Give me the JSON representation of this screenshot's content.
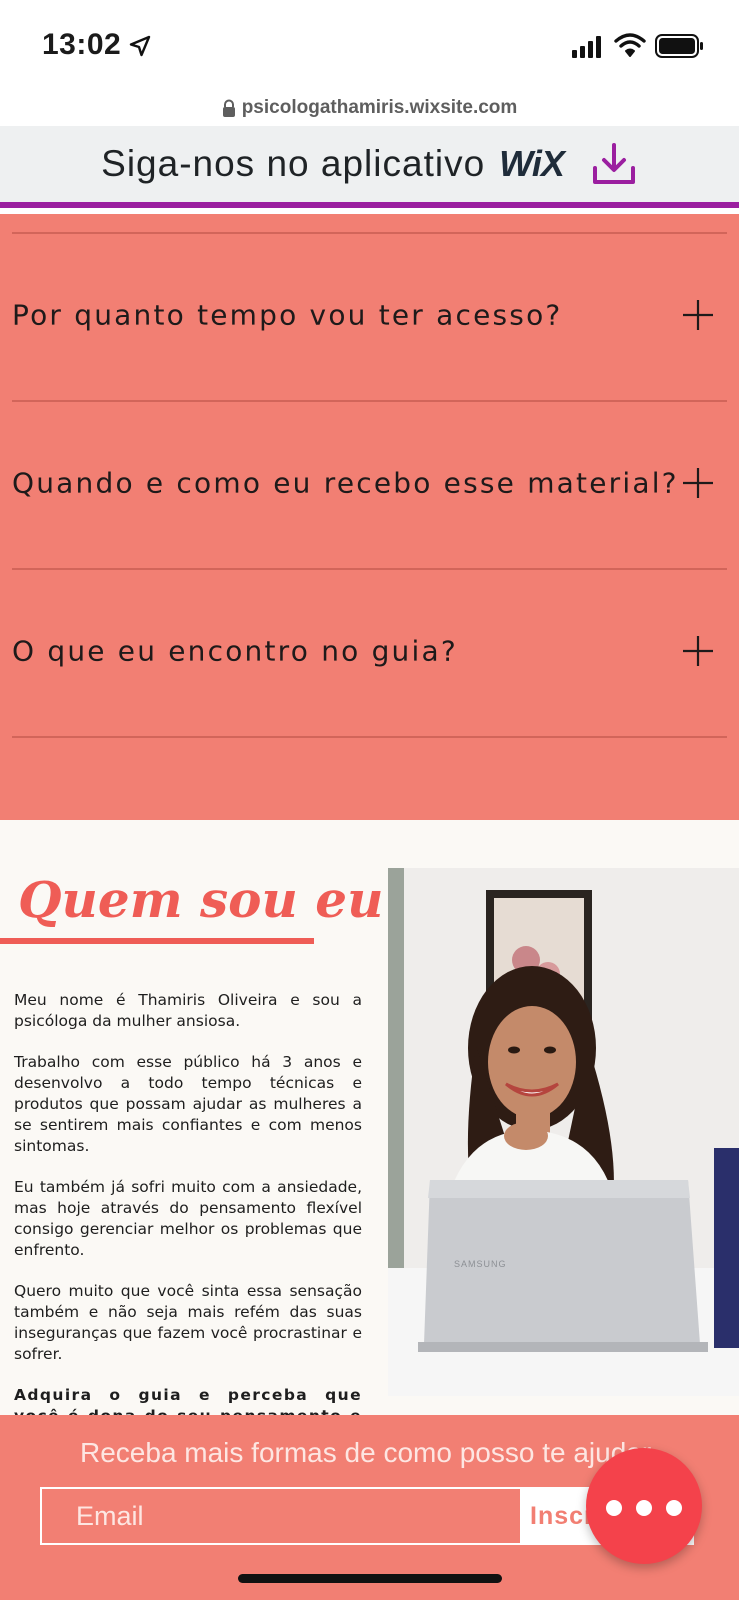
{
  "status_bar": {
    "time": "13:02"
  },
  "url_bar": {
    "url": "psicologathamiris.wixsite.com"
  },
  "banner": {
    "text": "Siga-nos no aplicativo",
    "logo": "WiX"
  },
  "faq": {
    "items": [
      {
        "question": "Por quanto tempo vou ter acesso?"
      },
      {
        "question": "Quando e como eu recebo esse material?"
      },
      {
        "question": "O que eu encontro no guia?"
      }
    ]
  },
  "about": {
    "title": "Quem sou eu?",
    "paragraphs": [
      "Meu nome é Thamiris Oliveira e sou a psicóloga da mulher ansiosa.",
      "Trabalho com esse público há 3 anos e desenvolvo a todo tempo técnicas e produtos que possam ajudar as mulheres a se sentirem mais confiantes e com menos sintomas.",
      "Eu também já sofri muito com a ansiedade, mas hoje através do pensamento flexível consigo gerenciar melhor os problemas que enfrento.",
      "Quero muito que você sinta essa sensação também e não seja mais refém das suas inseguranças que fazem você procrastinar e sofrer."
    ],
    "closing": "Adquira o guia e perceba que você é dona do seu pensamento e pode escolher viver bem!",
    "laptop_brand": "SAMSUNG"
  },
  "newsletter": {
    "title": "Receba mais formas de como posso te ajudar",
    "email_placeholder": "Email",
    "subscribe_label": "Inscrever"
  },
  "colors": {
    "accent": "#f27f73",
    "title": "#ef5d56",
    "banner_border": "#9b1fa0",
    "fab": "#f4424b"
  },
  "icons": [
    "location-arrow-icon",
    "signal-icon",
    "wifi-icon",
    "battery-icon",
    "lock-icon",
    "download-icon",
    "plus-icon",
    "more-dots-icon"
  ]
}
